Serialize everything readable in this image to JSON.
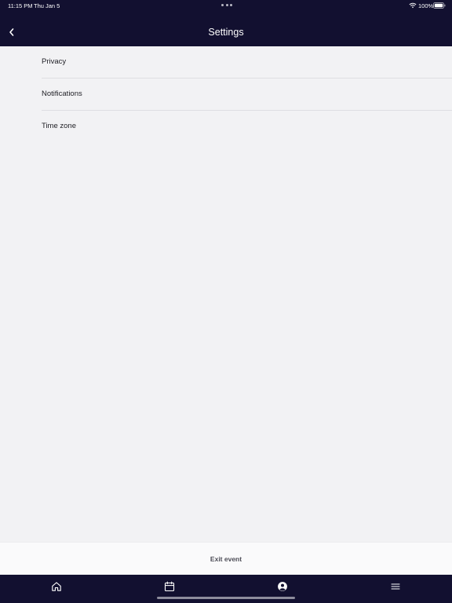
{
  "status_bar": {
    "time": "11:15 PM",
    "date": "Thu Jan 5",
    "battery": "100%",
    "icons": [
      "wifi-icon",
      "battery-icon"
    ]
  },
  "nav": {
    "title": "Settings",
    "back_icon": "chevron-left-icon"
  },
  "settings": {
    "items": [
      {
        "label": "Privacy"
      },
      {
        "label": "Notifications"
      },
      {
        "label": "Time zone"
      }
    ]
  },
  "footer": {
    "exit_label": "Exit event"
  },
  "tab_bar": {
    "tabs": [
      {
        "icon": "home-icon"
      },
      {
        "icon": "calendar-icon"
      },
      {
        "icon": "profile-icon",
        "active": true
      },
      {
        "icon": "menu-icon"
      }
    ]
  },
  "colors": {
    "header_bg": "#121030",
    "page_bg": "#f2f2f4",
    "text": "#1e1e24",
    "divider": "#dedee2"
  }
}
